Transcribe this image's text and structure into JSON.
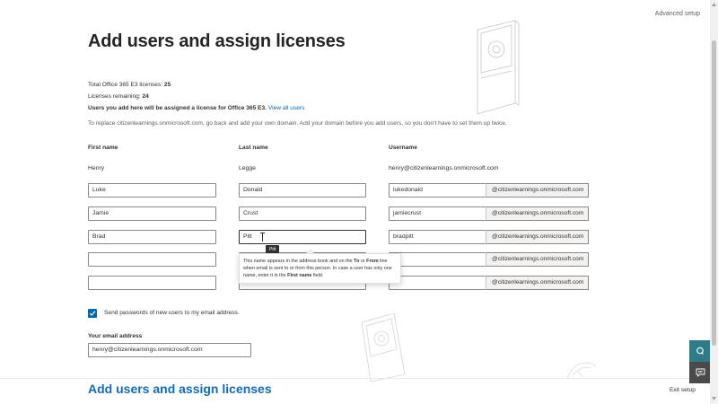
{
  "header": {
    "advanced_setup": "Advanced setup",
    "title": "Add users and assign licenses"
  },
  "info": {
    "total_prefix": "Total Office 365 E3 licenses: ",
    "total_value": "25",
    "remaining_prefix": "Licenses remaining: ",
    "remaining_value": "24",
    "assign_text": "Users you add here will be assigned a license for Office 365 E3. ",
    "view_all_link": "View all users",
    "domain_note": "To replace citizenlearnings.onmicrosoft.com, go back and add your own domain. Add your domain before you add users, so you don't have to set them up twice."
  },
  "columns": {
    "first_name": "First name",
    "last_name": "Last name",
    "username": "Username"
  },
  "owner": {
    "first": "Henry",
    "last": "Legge",
    "username": "henry@citizenlearnings.onmicrosoft.com"
  },
  "domain_suffix": "@citizenlearnings.onmicrosoft.com",
  "rows": [
    {
      "first": "Luke",
      "last": "Donald",
      "username": "lukedonald"
    },
    {
      "first": "Jamie",
      "last": "Crust",
      "username": "jamiecrust"
    },
    {
      "first": "Brad",
      "last": "Pitt",
      "username": "bradpitt"
    },
    {
      "first": "",
      "last": "",
      "username": ""
    },
    {
      "first": "",
      "last": "",
      "username": ""
    }
  ],
  "small_tooltip": "Pitt",
  "tooltip": {
    "part1": "This name appears in the address book and on the ",
    "to": "To",
    "part2": " or ",
    "from": "From",
    "part3": " line when email is sent to or from this person. In case a user has only one name, enter it in the ",
    "first_name": "First name",
    "part4": " field."
  },
  "send_passwords": {
    "checked": true,
    "label": "Send passwords of new users to my email address."
  },
  "email": {
    "label": "Your email address",
    "value": "henry@citizenlearnings.onmicrosoft.com"
  },
  "footer": {
    "title": "Add users and assign licenses",
    "exit_setup": "Exit setup"
  },
  "colors": {
    "accent": "#0067b8",
    "footer_title": "#0f6cbd",
    "chat_button": "#2f7b87",
    "feedback_button": "#4a4a4a"
  },
  "icons": {
    "checkbox": "checkmark-icon",
    "chat": "chat-icon",
    "feedback": "feedback-icon"
  }
}
